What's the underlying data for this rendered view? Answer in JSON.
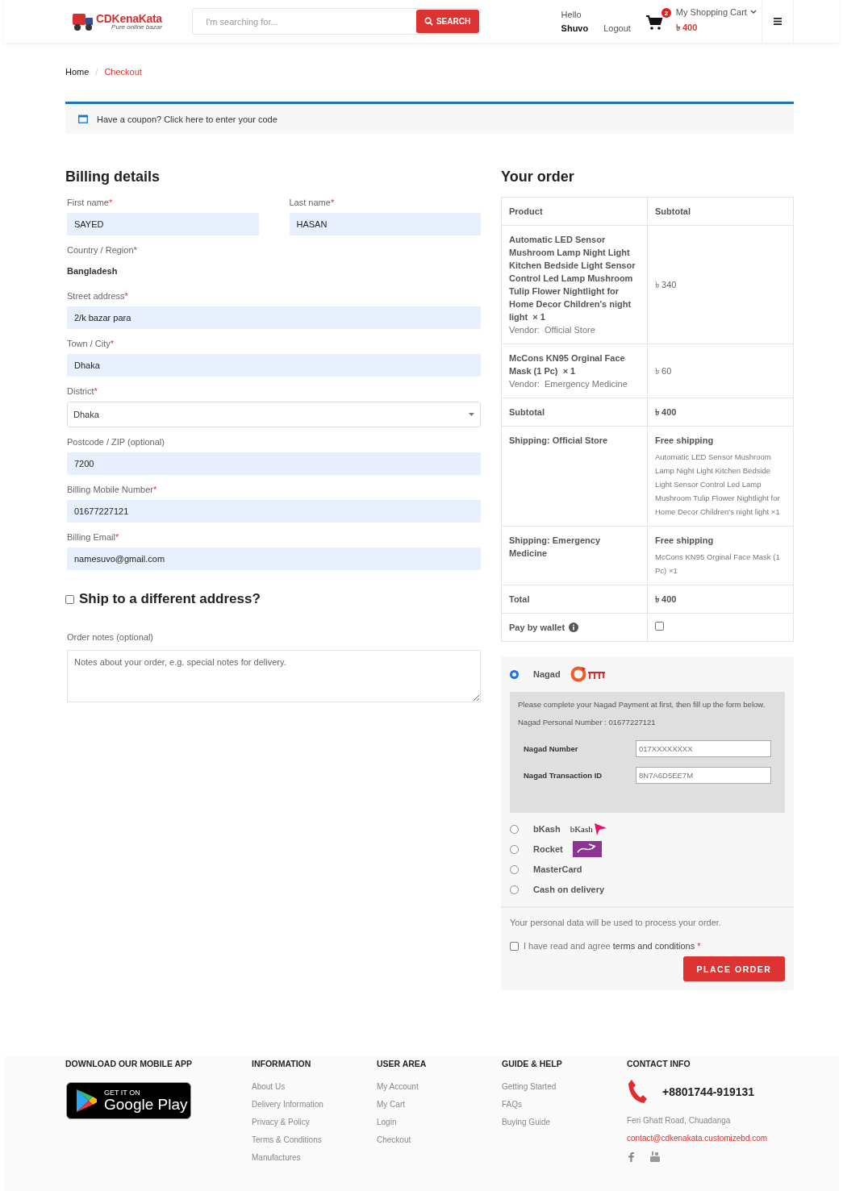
{
  "header": {
    "logo": {
      "name": "CDKenaKata",
      "tagline": "Pure online bazar"
    },
    "search": {
      "placeholder": "I'm searching for...",
      "button": "SEARCH"
    },
    "greeting": "Hello",
    "user": "Shuvo",
    "logout": "Logout",
    "cart_count": "2",
    "cart_label": "My Shopping Cart",
    "cart_total": "৳ 400"
  },
  "breadcrumb": {
    "separator": "/",
    "items": [
      {
        "label": "Home",
        "selected": false
      },
      {
        "label": "Checkout",
        "selected": true
      }
    ]
  },
  "coupon": "Have a coupon? Click here to enter your code",
  "billing": {
    "title": "Billing details",
    "name_fields": [
      {
        "label": "First name",
        "mark": "*",
        "kind": "input",
        "value": "SAYED"
      },
      {
        "label": "Last name",
        "mark": "*",
        "kind": "input",
        "value": "HASAN"
      }
    ],
    "fields": [
      {
        "label": "Country / Region",
        "mark": "*",
        "kind": "static",
        "value": "Bangladesh"
      },
      {
        "label": "Street address",
        "mark": "*",
        "kind": "input",
        "value": "2/k bazar para"
      },
      {
        "label": "Town / City",
        "mark": "*",
        "kind": "input",
        "value": "Dhaka"
      },
      {
        "label": "District",
        "mark": "*",
        "kind": "select",
        "value": "Dhaka"
      },
      {
        "label": "Postcode / ZIP (optional)",
        "kind": "input",
        "value": "7200"
      },
      {
        "label": "Billing Mobile Number",
        "mark": "*",
        "kind": "input",
        "value": "01677227121"
      },
      {
        "label": "Billing Email",
        "mark": "*",
        "kind": "input",
        "value": "namesuvo@gmail.com"
      }
    ]
  },
  "ship_different": {
    "label": "Ship to a different address?",
    "checked": false
  },
  "order_notes": {
    "label": "Order notes (optional)",
    "placeholder": "Notes about your order, e.g. special notes for delivery."
  },
  "order": {
    "title": "Your order",
    "columns": [
      "Product",
      "Subtotal"
    ],
    "items": [
      {
        "name": "Automatic LED Sensor Mushroom Lamp Night Light Kitchen Bedside Light Sensor Control Led Lamp Mushroom Tulip Flower Nightlight for Home Decor Children's night light",
        "qty": "× 1",
        "vendor_label": "Vendor:",
        "vendor": "Official Store",
        "price": "৳ 340"
      },
      {
        "name": "McCons KN95 Orginal Face Mask (1 Pc)",
        "qty": "× 1",
        "vendor_label": "Vendor:",
        "vendor": "Emergency Medicine",
        "price": "৳ 60"
      }
    ],
    "subtotal": {
      "label": "Subtotal",
      "value": "৳ 400"
    },
    "shipping": [
      {
        "label": "Shipping: Official Store",
        "method": "Free shipping",
        "detail": "Automatic LED Sensor Mushroom Lamp Night Light Kitchen Bedside Light Sensor Control Led Lamp Mushroom Tulip Flower Nightlight for Home Decor Children's night light ×1"
      },
      {
        "label": "Shipping: Emergency Medicine",
        "method": "Free shipping",
        "detail": "McCons KN95 Orginal Face Mask (1 Pc) ×1"
      }
    ],
    "total": {
      "label": "Total",
      "value": "৳ 400"
    },
    "wallet": {
      "label": "Pay by wallet",
      "checked": false
    }
  },
  "payment": {
    "methods": [
      {
        "label": "Nagad",
        "kind": "nagad",
        "selected": true
      },
      {
        "label": "bKash",
        "kind": "bkash",
        "logo_text": "bKash",
        "selected": false
      },
      {
        "label": "Rocket",
        "kind": "rocket",
        "selected": false
      },
      {
        "label": "MasterCard",
        "kind": "card",
        "selected": false
      },
      {
        "label": "Cash on delivery",
        "kind": "cash",
        "selected": false
      }
    ],
    "panel": {
      "instructions": "Please complete your Nagad Payment at first, then fill up the form below.",
      "personal_number": "Nagad Personal Number : 01677227121",
      "fields": [
        {
          "label": "Nagad Number",
          "placeholder": "017XXXXXXXX"
        },
        {
          "label": "Nagad Transaction ID",
          "placeholder": "8N7A6D5EE7M"
        }
      ]
    },
    "privacy": "Your personal data will be used to process your order.",
    "terms": {
      "prefix": "I have read and agree",
      "link": "terms and conditions",
      "mark": "*",
      "checked": false
    },
    "button": "PLACE ORDER"
  },
  "footer": {
    "app": {
      "title": "DOWNLOAD OUR MOBILE APP",
      "badge_small": "GET IT ON",
      "badge_big": "Google Play"
    },
    "columns": [
      {
        "title": "INFORMATION",
        "links": [
          "About Us",
          "Delivery Information",
          "Privacy & Policy",
          "Terms & Conditions",
          "Manufactures"
        ]
      },
      {
        "title": "USER AREA",
        "links": [
          "My Account",
          "My Cart",
          "Login",
          "Checkout"
        ]
      },
      {
        "title": "GUIDE & HELP",
        "links": [
          "Getting Started",
          "FAQs",
          "Buying Guide"
        ]
      }
    ],
    "contact": {
      "title": "CONTACT INFO",
      "phone": "+8801744-919131",
      "address": "Feri Ghatt Road, Chuadanga",
      "email": "contact@cdkenakata.customizebd.com"
    }
  }
}
